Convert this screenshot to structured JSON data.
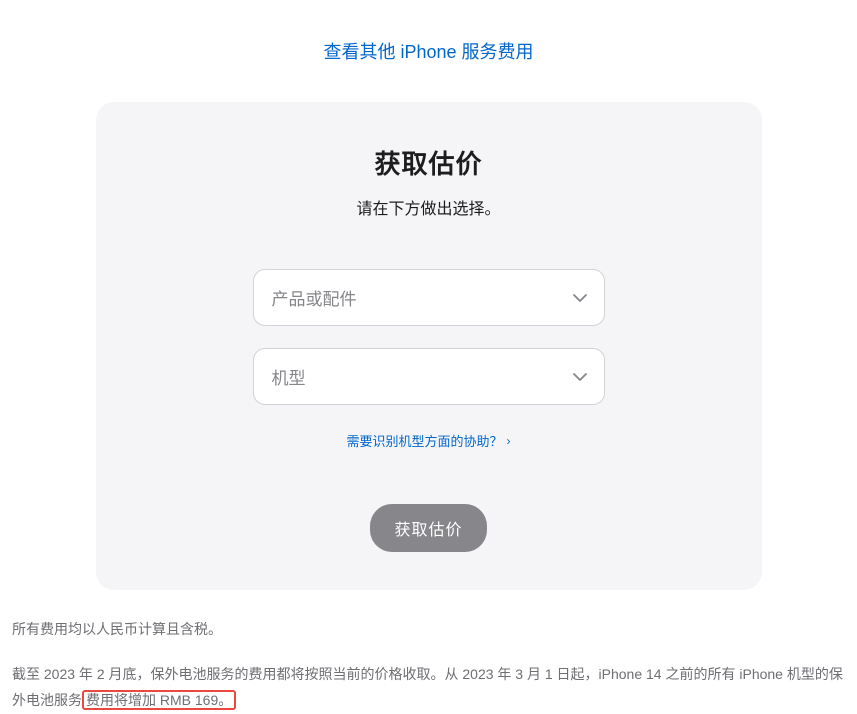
{
  "topLink": {
    "label": "查看其他 iPhone 服务费用"
  },
  "card": {
    "title": "获取估价",
    "subtitle": "请在下方做出选择。",
    "select1": {
      "placeholder": "产品或配件"
    },
    "select2": {
      "placeholder": "机型"
    },
    "helpLink": {
      "label": "需要识别机型方面的协助？"
    },
    "button": {
      "label": "获取估价"
    }
  },
  "footer": {
    "line1": "所有费用均以人民币计算且含税。",
    "line2_part1": "截至 2023 年 2 月底，保外电池服务的费用都将按照当前的价格收取。从 2023 年 3 月 1 日起，iPhone 14 之前的所有 iPhone 机型的保外电池服务",
    "line2_highlight": "费用将增加 RMB 169。"
  }
}
